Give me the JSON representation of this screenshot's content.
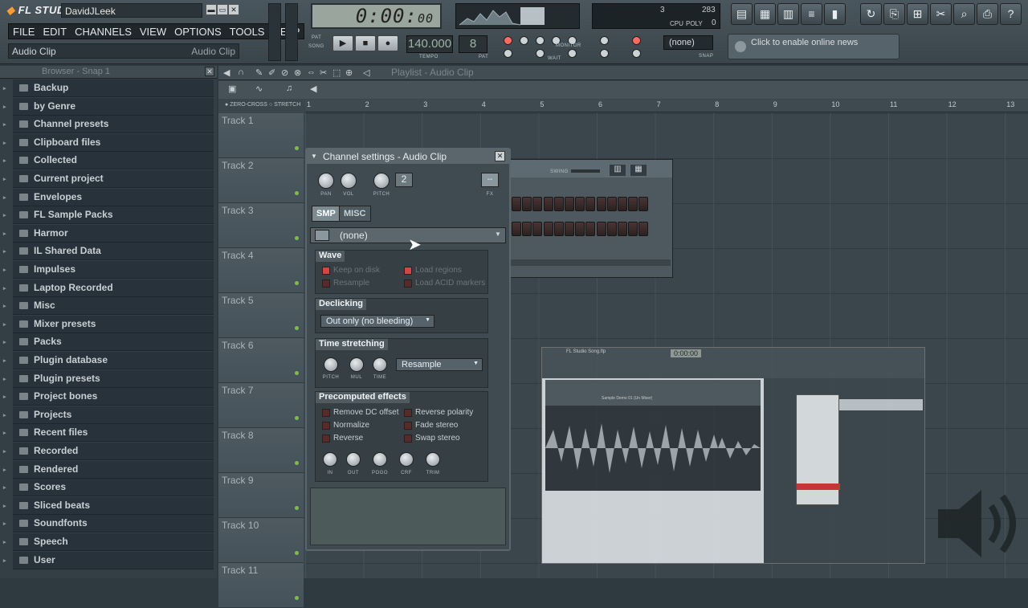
{
  "app": {
    "logo": "FL STUDIO",
    "username": "DavidJLeek",
    "hint_left": "Audio Clip",
    "hint_right": "Audio Clip"
  },
  "menu": [
    "FILE",
    "EDIT",
    "CHANNELS",
    "VIEW",
    "OPTIONS",
    "TOOLS",
    "HELP"
  ],
  "transport": {
    "time": "0:00",
    "time_small": "00",
    "tempo": "140.000",
    "tempo_label": "TEMPO",
    "pattern": "8",
    "pattern_label": "PAT",
    "pat_label": "PAT",
    "song_label": "SONG",
    "monitor_label": "MONITOR",
    "wait_label": "WAIT",
    "snap_label": "SNAP",
    "pattern_select": "(none)",
    "cpu_label": "CPU",
    "poly_label": "POLY",
    "cpu_value": "3",
    "num_value": "283",
    "poly_value": "0"
  },
  "news": {
    "text": "Click to enable online news"
  },
  "browser": {
    "title": "Browser - Snap 1",
    "items": [
      "Backup",
      "by Genre",
      "Channel presets",
      "Clipboard files",
      "Collected",
      "Current project",
      "Envelopes",
      "FL Sample Packs",
      "Harmor",
      "IL Shared Data",
      "Impulses",
      "Laptop Recorded",
      "Misc",
      "Mixer presets",
      "Packs",
      "Plugin database",
      "Plugin presets",
      "Project bones",
      "Projects",
      "Recent files",
      "Recorded",
      "Rendered",
      "Scores",
      "Sliced beats",
      "Soundfonts",
      "Speech",
      "User"
    ]
  },
  "playlist": {
    "title": "Playlist - Audio Clip",
    "zero_cross": "ZERO-CROSS",
    "stretch": "STRETCH",
    "ruler": [
      "1",
      "2",
      "3",
      "4",
      "5",
      "6",
      "7",
      "8",
      "9",
      "10",
      "11",
      "12",
      "13"
    ],
    "tracks": [
      "Track 1",
      "Track 2",
      "Track 3",
      "Track 4",
      "Track 5",
      "Track 6",
      "Track 7",
      "Track 8",
      "Track 9",
      "Track 10",
      "Track 11"
    ]
  },
  "stepseq": {
    "swing_label": "SWING"
  },
  "channel": {
    "title": "Channel settings - Audio Clip",
    "knob_labels": [
      "PAN",
      "VOL",
      "PITCH"
    ],
    "range_value": "2",
    "fx_label": "FX",
    "tabs": [
      "SMP",
      "MISC"
    ],
    "sample": "(none)",
    "wave": {
      "title": "Wave",
      "options": [
        "Keep on disk",
        "Resample",
        "Load regions",
        "Load ACID markers"
      ]
    },
    "declicking": {
      "title": "Declicking",
      "value": "Out only (no bleeding)"
    },
    "time_stretching": {
      "title": "Time stretching",
      "knobs": [
        "PITCH",
        "MUL",
        "TIME"
      ],
      "mode": "Resample"
    },
    "precomputed": {
      "title": "Precomputed effects",
      "options": [
        "Remove DC offset",
        "Reverse polarity",
        "Normalize",
        "Fade stereo",
        "Reverse",
        "Swap stereo"
      ],
      "knobs": [
        "IN",
        "OUT",
        "POGO",
        "CRF",
        "TRIM"
      ]
    }
  },
  "thumbnail": {
    "window_title": "FL Studio Song.flp",
    "time": "0:00:00",
    "sample_title": "Sample Demo 01 (Un Mixer)"
  },
  "colors": {
    "accent": "#ff9a2e",
    "checkbox_on": "#d0483f",
    "led": "#7fbf3f"
  }
}
